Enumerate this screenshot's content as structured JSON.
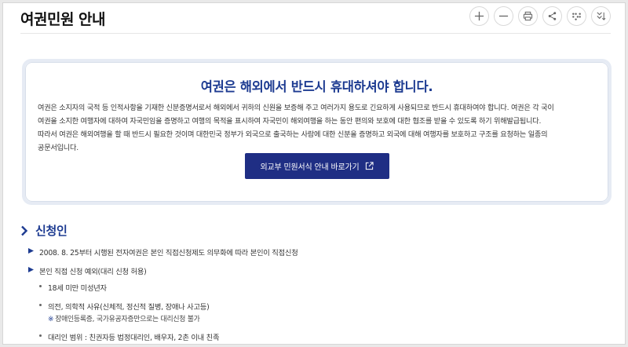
{
  "header": {
    "title": "여권민원 안내",
    "tools": [
      {
        "name": "zoom-in-icon"
      },
      {
        "name": "zoom-out-icon"
      },
      {
        "name": "print-icon"
      },
      {
        "name": "share-icon"
      },
      {
        "name": "braille-icon"
      },
      {
        "name": "collapse-icon"
      }
    ]
  },
  "info": {
    "title": "여권은 해외에서 반드시 휴대하셔야 합니다.",
    "lines": [
      "여권은 소지자의 국적 등 인적사항을 기재한 신분증명서로서 해외에서 귀하의 신원을 보증해 주고 여러가지 용도로 긴요하게 사용되므로 반드시 휴대하여야 합니다. 여권은 각 국이",
      "여권을 소지한 여행자에 대하여 자국민임을 증명하고 여행의 목적을 표시하여 자국민이 해외여행을 하는 동안 편의와 보호에 대한 협조를 받을 수 있도록 하기 위해발급됩니다.",
      "따라서 여권은 해외여행을 할 때 반드시 필요한 것이며 대한민국 정부가 외국으로 출국하는 사람에 대한 신분을 증명하고 외국에 대해 여행자를 보호하고 구조를 요청하는 일종의",
      "공문서입니다."
    ],
    "button_label": "외교부 민원서식 안내 바로가기",
    "button_icon": "external-link-icon"
  },
  "section": {
    "title": "신청인",
    "items": [
      {
        "text": "2008. 8. 25부터 시행된 전자여권은 본인 직접신청제도 의무화에 따라 본인이 직접신청"
      },
      {
        "text": "본인 직접 신청 예외(대리 신청 허용)"
      }
    ],
    "subitems": [
      {
        "text": "18세 미만 미성년자"
      },
      {
        "text": "의전, 의학적 사유(신체적, 정신적 질병, 장애나 사고등)"
      },
      {
        "text": "대리인 범위 : 친권자등 법정대리인, 배우자, 2촌 이내 친족"
      }
    ],
    "note": "장애인등록증, 국가유공자증만으로는 대리신청 불가",
    "note_mark": "※"
  },
  "colors": {
    "accent": "#1d3b91",
    "button_bg": "#1f2e84"
  }
}
